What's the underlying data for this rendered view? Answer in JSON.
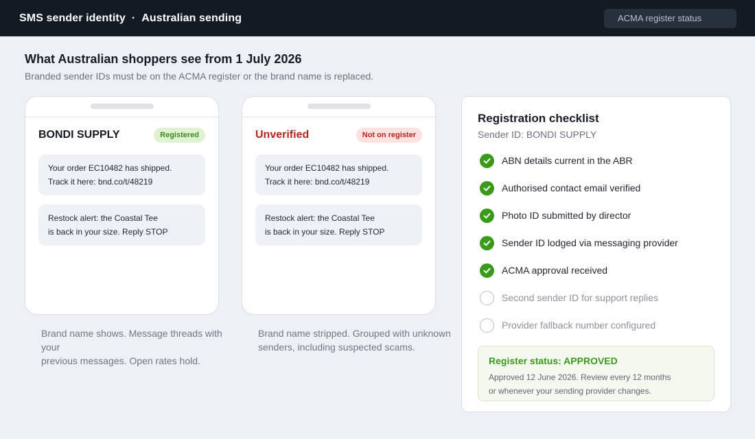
{
  "header": {
    "app_title": "SMS sender identity",
    "separator": "·",
    "section_title": "Australian sending",
    "status_link": "ACMA register status"
  },
  "intro": {
    "heading": "What Australian shoppers see from 1 July 2026",
    "subheading": "Branded sender IDs must be on the ACMA register or the brand name is replaced."
  },
  "phones": [
    {
      "sender": "BONDI SUPPLY",
      "badge": "Registered",
      "messages": [
        [
          "Your order EC10482 has shipped.",
          "Track it here: bnd.co/t/48219"
        ],
        [
          "Restock alert: the Coastal Tee",
          "is back in your size. Reply STOP"
        ]
      ],
      "caption": [
        "Brand name shows. Message threads with your",
        "previous messages. Open rates hold."
      ]
    },
    {
      "sender": "Unverified",
      "badge": "Not on register",
      "messages": [
        [
          "Your order EC10482 has shipped.",
          "Track it here: bnd.co/t/48219"
        ],
        [
          "Restock alert: the Coastal Tee",
          "is back in your size. Reply STOP"
        ]
      ],
      "caption": [
        "Brand name stripped. Grouped with unknown",
        "senders, including suspected scams."
      ]
    }
  ],
  "checklist": {
    "title": "Registration checklist",
    "sender_id": "Sender ID: BONDI SUPPLY",
    "items": [
      {
        "label": "ABN details current in the ABR",
        "done": true
      },
      {
        "label": "Authorised contact email verified",
        "done": true
      },
      {
        "label": "Photo ID submitted by director",
        "done": true
      },
      {
        "label": "Sender ID lodged via messaging provider",
        "done": true
      },
      {
        "label": "ACMA approval received",
        "done": true
      },
      {
        "label": "Second sender ID for support replies",
        "done": false
      },
      {
        "label": "Provider fallback number configured",
        "done": false
      }
    ],
    "status": {
      "label": "Register status: APPROVED",
      "note": [
        "Approved 12 June 2026. Review every 12 months",
        "or whenever your sending provider changes."
      ]
    }
  },
  "colors": {
    "topbar": "#131a23",
    "success": "#3a9a1a",
    "danger": "#b3261e",
    "background": "#edf1f6"
  }
}
